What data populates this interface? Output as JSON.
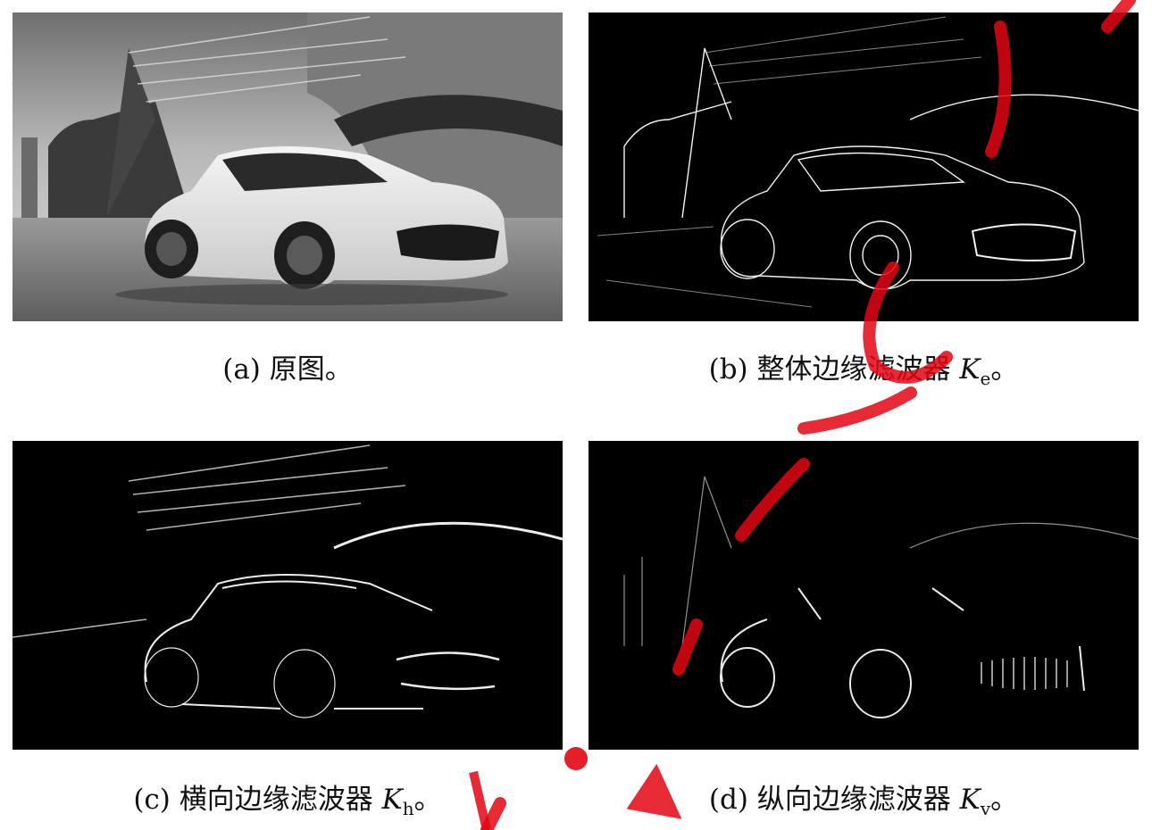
{
  "figure": {
    "panels": [
      {
        "id": "a",
        "label": "(a)",
        "text": "原图。",
        "symbol": "",
        "subscript": ""
      },
      {
        "id": "b",
        "label": "(b)",
        "text": "整体边缘滤波器",
        "symbol": "K",
        "subscript": "e",
        "end": "。"
      },
      {
        "id": "c",
        "label": "(c)",
        "text": "横向边缘滤波器",
        "symbol": "K",
        "subscript": "h",
        "end": "。"
      },
      {
        "id": "d",
        "label": "(d)",
        "text": "纵向边缘滤波器",
        "symbol": "K",
        "subscript": "v",
        "end": "。"
      }
    ]
  },
  "colors": {
    "watermark": "#e30613",
    "edge_background": "#000000",
    "edge_lines": "#f2f2f2"
  }
}
